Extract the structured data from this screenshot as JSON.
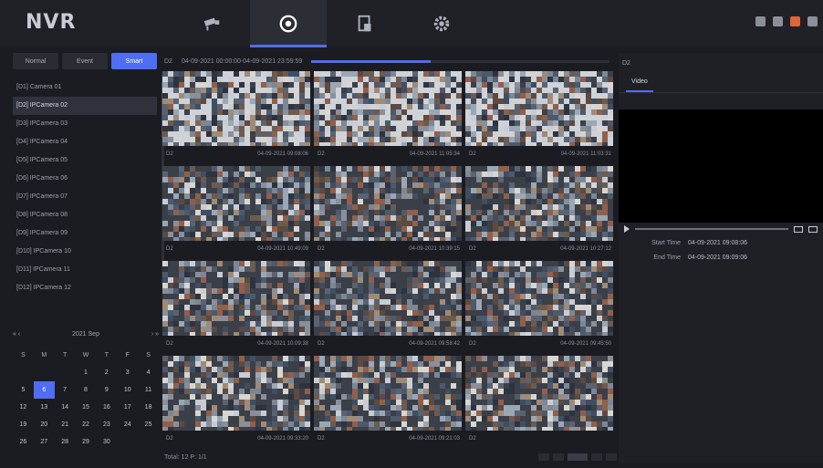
{
  "app": {
    "logo": "NVR"
  },
  "nav": [
    {
      "icon": "camera-icon",
      "active": false
    },
    {
      "icon": "playback-icon",
      "active": true
    },
    {
      "icon": "file-icon",
      "active": false
    },
    {
      "icon": "settings-icon",
      "active": false
    }
  ],
  "top_icons": [
    {
      "icon": "status-icon",
      "color": "#8a8f99"
    },
    {
      "icon": "monitor-icon",
      "color": "#8a8f99"
    },
    {
      "icon": "alarm-icon",
      "color": "#e0643a"
    },
    {
      "icon": "user-icon",
      "color": "#8a8f99"
    }
  ],
  "left": {
    "modes": [
      "Normal",
      "Event",
      "Smart"
    ],
    "active_mode": 2,
    "cameras": [
      "[D1] Camera 01",
      "[D2] IPCamera 02",
      "[D3] IPCamera 03",
      "[D4] IPCamera 04",
      "[D5] IPCamera 05",
      "[D6] IPCamera 06",
      "[D7] IPCamera 07",
      "[D8] IPCamera 08",
      "[D9] IPCamera 09",
      "[D10] IPCamera 10",
      "[D11] IPCamera 11",
      "[D12] IPCamera 12"
    ],
    "selected_camera": 1,
    "calendar": {
      "prev": "« ‹",
      "month": "2021 Sep",
      "next": "› »",
      "weekdays": [
        "S",
        "M",
        "T",
        "W",
        "T",
        "F",
        "S"
      ],
      "days": [
        "",
        "",
        "",
        "1",
        "2",
        "3",
        "4",
        "5",
        "6",
        "7",
        "8",
        "9",
        "10",
        "11",
        "12",
        "13",
        "14",
        "15",
        "16",
        "17",
        "18",
        "19",
        "20",
        "21",
        "22",
        "23",
        "24",
        "25",
        "26",
        "27",
        "28",
        "29",
        "30",
        "",
        ""
      ],
      "selected_day": "6"
    }
  },
  "main": {
    "header": "D2",
    "time_range": "04-09-2021 00:00:00-04-09-2021 23:59:59",
    "progress": 0.4,
    "tiles": [
      {
        "id": "D2",
        "time": "04-09-2021 09:08:06"
      },
      {
        "id": "D2",
        "time": "04-09-2021 11:05:34"
      },
      {
        "id": "D2",
        "time": "04-09-2021 11:03:31"
      },
      {
        "id": "D2",
        "time": "04-09-2021 10:49:09"
      },
      {
        "id": "D2",
        "time": "04-09-2021 10:39:15"
      },
      {
        "id": "D2",
        "time": "04-09-2021 10:27:12"
      },
      {
        "id": "D2",
        "time": "04-09-2021 10:09:38"
      },
      {
        "id": "D2",
        "time": "04-09-2021 09:58:42"
      },
      {
        "id": "D2",
        "time": "04-09-2021 09:45:50"
      },
      {
        "id": "D2",
        "time": "04-09-2021 09:33:20"
      },
      {
        "id": "D2",
        "time": "04-09-2021 09:21:03"
      },
      {
        "id": "D2",
        "time": ""
      }
    ],
    "footer": "Total: 12  P: 1/1"
  },
  "right": {
    "title": "D2",
    "tab": "Video",
    "start_label": "Start Time",
    "start_value": "04-09-2021 09:08:06",
    "end_label": "End Time",
    "end_value": "04-09-2021 09:09:06"
  }
}
